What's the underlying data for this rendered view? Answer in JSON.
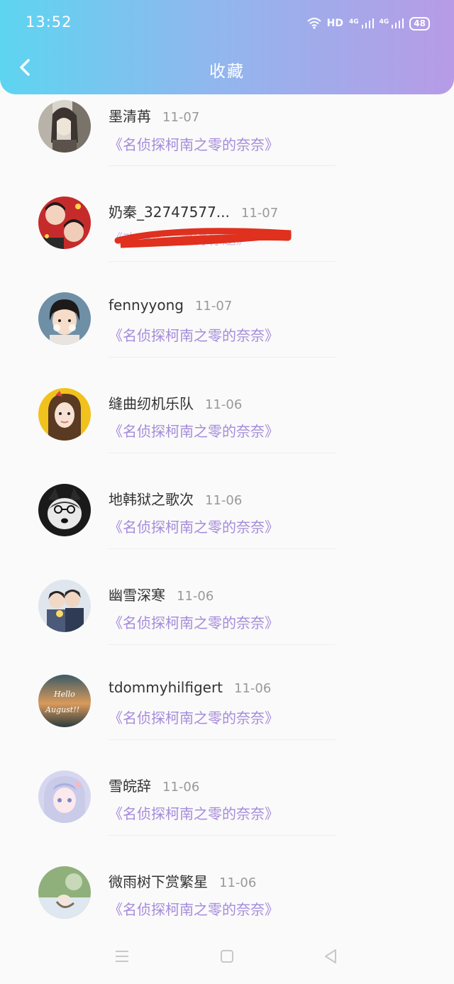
{
  "status_bar": {
    "time": "13:52",
    "hd_label": "HD",
    "network_1": "4G",
    "network_2": "4G",
    "battery": "48"
  },
  "header": {
    "title": "收藏"
  },
  "entries": [
    {
      "name": "墨清苒",
      "date": "11-07",
      "work": "《名侦探柯南之零的奈奈》",
      "avatar_icon": "avatar-image"
    },
    {
      "name": "奶秦_32747577...",
      "date": "11-07",
      "work": "《欢乐颂，主得标题》",
      "avatar_icon": "avatar-image",
      "work_redacted": true
    },
    {
      "name": "fennyyong",
      "date": "11-07",
      "work": "《名侦探柯南之零的奈奈》",
      "avatar_icon": "avatar-image"
    },
    {
      "name": "缝曲纫机乐队",
      "date": "11-06",
      "work": "《名侦探柯南之零的奈奈》",
      "avatar_icon": "avatar-image"
    },
    {
      "name": "地韩狱之歌次",
      "date": "11-06",
      "work": "《名侦探柯南之零的奈奈》",
      "avatar_icon": "avatar-image"
    },
    {
      "name": "幽雪深寒",
      "date": "11-06",
      "work": "《名侦探柯南之零的奈奈》",
      "avatar_icon": "avatar-image"
    },
    {
      "name": "tdommyhilfigert",
      "date": "11-06",
      "work": "《名侦探柯南之零的奈奈》",
      "avatar_icon": "avatar-image",
      "avatar_text": [
        "Hello",
        "August!!"
      ]
    },
    {
      "name": "雪皖辞",
      "date": "11-06",
      "work": "《名侦探柯南之零的奈奈》",
      "avatar_icon": "avatar-image"
    },
    {
      "name": "微雨树下赏繁星",
      "date": "11-06",
      "work": "《名侦探柯南之零的奈奈》",
      "avatar_icon": "avatar-image"
    }
  ],
  "nav": {
    "menu_icon": "menu-icon",
    "home_icon": "home-square-icon",
    "back_icon": "back-triangle-icon"
  },
  "colors": {
    "header_gradient": [
      "#5dd5f0",
      "#8fb8ee",
      "#b79be6"
    ],
    "link": "#a58bdb",
    "redaction": "#e0301e"
  }
}
